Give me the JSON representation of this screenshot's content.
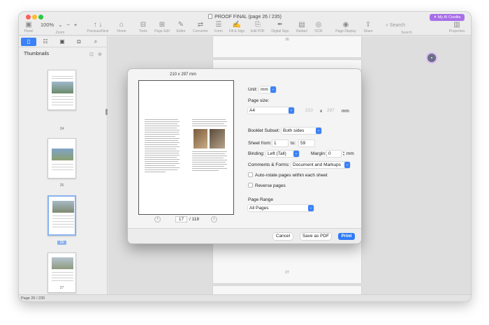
{
  "window": {
    "title": "PROOF FINAL (page 26 / 235)",
    "ai_credits_label": "My AI Credits"
  },
  "toolbar": {
    "panel": "Panel",
    "zoom_value": "100%",
    "zoom_label": "Zoom",
    "previous_next": "Previous/Next",
    "home": "Home",
    "tools": "Tools",
    "page_edit": "Page Edit",
    "edit": "Editor",
    "converter": "Converter",
    "form": "Form",
    "fill_sign": "Fill & Sign",
    "edit_pdf": "Edit PDF",
    "digital_sign": "Digital Sign",
    "redact": "Redact",
    "ocr": "OCR",
    "page_display": "Page Display",
    "share": "Share",
    "search_placeholder": "Search",
    "search_label": "Search",
    "properties": "Properties"
  },
  "sidebar": {
    "title": "Thumbnails",
    "thumbnails": [
      {
        "label": "24"
      },
      {
        "label": "25"
      },
      {
        "label": "26"
      },
      {
        "label": "27"
      }
    ]
  },
  "canvas": {
    "page_label_top": "26",
    "page_label_bottom": "27"
  },
  "status_bar": {
    "page_info": "Page 26 / 235"
  },
  "dialog": {
    "paper_size_text": "210 x 297 mm",
    "pager": {
      "current": "17",
      "total": "/ 118"
    },
    "unit_label": "Unit:",
    "unit_value": "mm",
    "page_size_label": "Page size:",
    "page_size_value": "A4",
    "width_value": "210",
    "times": "x",
    "height_value": "297",
    "size_unit": "mm",
    "booklet_subset_label": "Booklet Subset:",
    "booklet_subset_value": "Both sides",
    "sheet_from_label": "Sheet from:",
    "sheet_from_value": "1",
    "sheet_to_label": "to:",
    "sheet_to_value": "59",
    "binding_label": "Binding:",
    "binding_value": "Left (Tall)",
    "margin_label": "Margin:",
    "margin_value": "0",
    "margin_unit": "mm",
    "comments_label": "Comments & Forms:",
    "comments_value": "Document and Markups",
    "auto_rotate_label": "Auto-rotate pages within each sheet",
    "reverse_label": "Reverse pages",
    "page_range_label": "Page Range",
    "page_range_value": "All Pages",
    "cancel_button": "Cancel",
    "save_pdf_button": "Save as PDF",
    "print_button": "Print"
  },
  "colors": {
    "accent": "#2f7bf5",
    "ai_button": "#a86ee8"
  }
}
